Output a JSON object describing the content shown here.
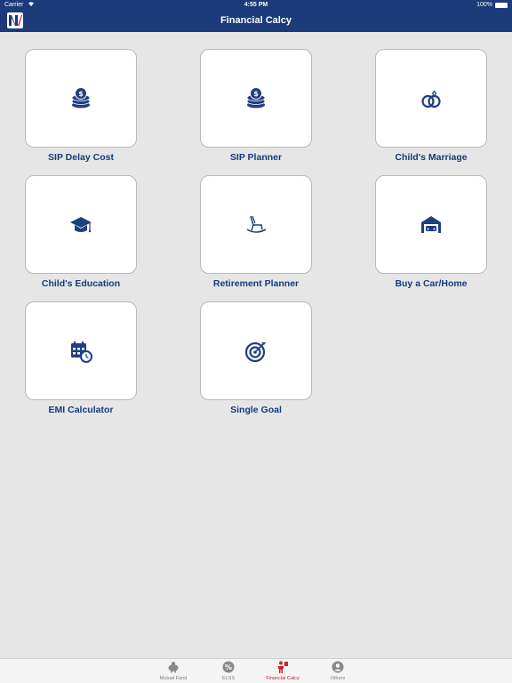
{
  "status_bar": {
    "carrier": "Carrier",
    "time": "4:55 PM",
    "battery": "100%"
  },
  "header": {
    "title": "Financial Calcy"
  },
  "calculators": [
    {
      "label": "SIP Delay Cost",
      "icon": "coins-stack-icon"
    },
    {
      "label": "SIP Planner",
      "icon": "coins-stack-icon"
    },
    {
      "label": "Child's Marriage",
      "icon": "wedding-rings-icon"
    },
    {
      "label": "Child's Education",
      "icon": "graduation-cap-icon"
    },
    {
      "label": "Retirement Planner",
      "icon": "rocking-chair-icon"
    },
    {
      "label": "Buy a Car/Home",
      "icon": "car-garage-icon"
    },
    {
      "label": "EMI Calculator",
      "icon": "calendar-clock-icon"
    },
    {
      "label": "Single Goal",
      "icon": "target-icon"
    }
  ],
  "tabs": [
    {
      "label": "Mutual Fund",
      "icon": "piggy-bank-icon",
      "active": false
    },
    {
      "label": "ELSS",
      "icon": "percent-icon",
      "active": false
    },
    {
      "label": "Financial Calcy",
      "icon": "person-calculator-icon",
      "active": true
    },
    {
      "label": "Others",
      "icon": "user-icon",
      "active": false
    }
  ],
  "colors": {
    "header_bg": "#1a3a7a",
    "label_text": "#163a7a",
    "icon": "#1f3f80",
    "tab_active": "#d0202a",
    "tab_inactive": "#7a7a7a",
    "background": "#e6e6e6"
  }
}
